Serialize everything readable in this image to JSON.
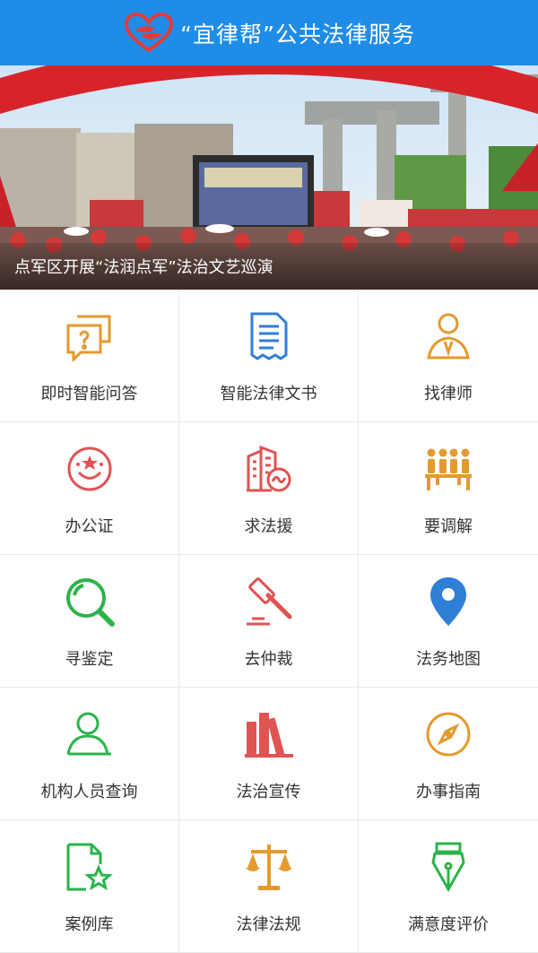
{
  "header": {
    "title": "“宜律帮”公共法律服务",
    "logo_icon": "heart-logo-icon",
    "background_color": "#1f8de8"
  },
  "banner": {
    "caption": "点军区开展“法润点军”法治文艺巡演"
  },
  "services": [
    {
      "label": "即时智能问答",
      "icon": "chat-question-icon",
      "color": "#e39a2f"
    },
    {
      "label": "智能法律文书",
      "icon": "document-icon",
      "color": "#2f7fd6"
    },
    {
      "label": "找律师",
      "icon": "lawyer-person-icon",
      "color": "#e39a2f"
    },
    {
      "label": "办公证",
      "icon": "notary-seal-icon",
      "color": "#e05353"
    },
    {
      "label": "求法援",
      "icon": "building-aid-icon",
      "color": "#e05353"
    },
    {
      "label": "要调解",
      "icon": "mediation-people-icon",
      "color": "#e39a2f"
    },
    {
      "label": "寻鉴定",
      "icon": "magnifier-icon",
      "color": "#2bb34a"
    },
    {
      "label": "去仲裁",
      "icon": "gavel-icon",
      "color": "#e05353"
    },
    {
      "label": "法务地图",
      "icon": "map-pin-icon",
      "color": "#2f7fd6"
    },
    {
      "label": "机构人员查询",
      "icon": "person-search-icon",
      "color": "#2bb34a"
    },
    {
      "label": "法治宣传",
      "icon": "books-icon",
      "color": "#e05353"
    },
    {
      "label": "办事指南",
      "icon": "compass-icon",
      "color": "#e39a2f"
    },
    {
      "label": "案例库",
      "icon": "case-file-star-icon",
      "color": "#2bb34a"
    },
    {
      "label": "法律法规",
      "icon": "scales-icon",
      "color": "#e39a2f"
    },
    {
      "label": "满意度评价",
      "icon": "pen-nib-icon",
      "color": "#2bb34a"
    }
  ]
}
